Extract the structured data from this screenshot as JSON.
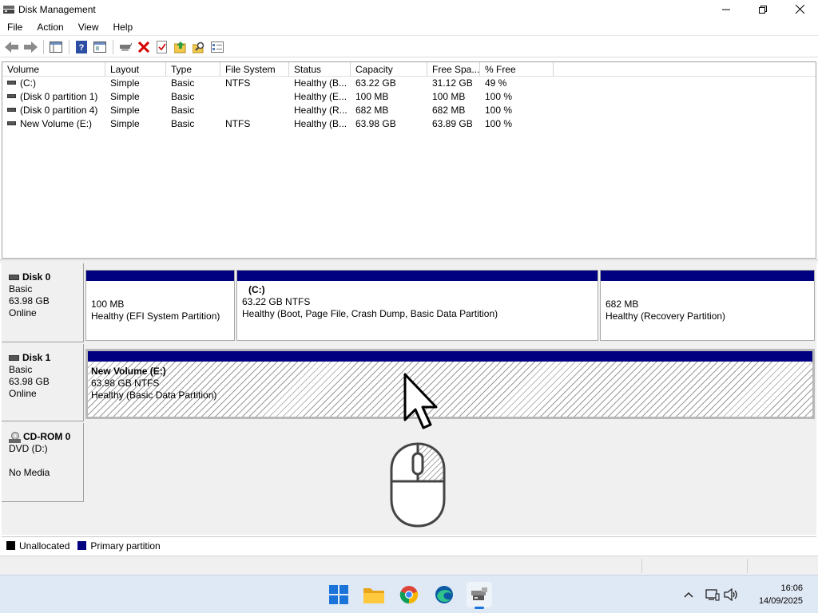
{
  "window": {
    "title": "Disk Management",
    "minimize": "─",
    "maximize": "❐",
    "close": "✕"
  },
  "menu": [
    "File",
    "Action",
    "View",
    "Help"
  ],
  "toolbar": {
    "buttons": [
      "back-icon",
      "forward-icon",
      "console-tree-icon",
      "help-icon",
      "properties-icon",
      "connect-icon",
      "delete-icon",
      "checklist-icon",
      "import-icon",
      "search-icon",
      "view-icon"
    ]
  },
  "volume_list": {
    "headers": [
      "Volume",
      "Layout",
      "Type",
      "File System",
      "Status",
      "Capacity",
      "Free Spa...",
      "% Free"
    ],
    "rows": [
      [
        "(C:)",
        "Simple",
        "Basic",
        "NTFS",
        "Healthy (B...",
        "63.22 GB",
        "31.12 GB",
        "49 %"
      ],
      [
        "(Disk 0 partition 1)",
        "Simple",
        "Basic",
        "",
        "Healthy (E...",
        "100 MB",
        "100 MB",
        "100 %"
      ],
      [
        "(Disk 0 partition 4)",
        "Simple",
        "Basic",
        "",
        "Healthy (R...",
        "682 MB",
        "682 MB",
        "100 %"
      ],
      [
        "New Volume (E:)",
        "Simple",
        "Basic",
        "NTFS",
        "Healthy (B...",
        "63.98 GB",
        "63.89 GB",
        "100 %"
      ]
    ]
  },
  "disks": [
    {
      "name": "Disk 0",
      "type": "Basic",
      "size": "63.98 GB",
      "state": "Online",
      "partitions": [
        {
          "name": "",
          "size": "100 MB",
          "status": "Healthy (EFI System Partition)"
        },
        {
          "name": "(C:)",
          "size": "63.22 GB NTFS",
          "status": "Healthy (Boot, Page File, Crash Dump, Basic Data Partition)"
        },
        {
          "name": "",
          "size": "682 MB",
          "status": "Healthy (Recovery Partition)"
        }
      ]
    },
    {
      "name": "Disk 1",
      "type": "Basic",
      "size": "63.98 GB",
      "state": "Online",
      "partitions": [
        {
          "name": "New Volume  (E:)",
          "size": "63.98 GB NTFS",
          "status": "Healthy (Basic Data Partition)"
        }
      ]
    },
    {
      "name": "CD-ROM 0",
      "type": "DVD (D:)",
      "state": "No Media"
    }
  ],
  "legend": [
    {
      "label": "Unallocated",
      "color": "#000000"
    },
    {
      "label": "Primary partition",
      "color": "#000080"
    }
  ],
  "taskbar": {
    "apps": [
      "windows-start-icon",
      "file-explorer-icon",
      "chrome-icon",
      "edge-icon",
      "disk-management-icon"
    ],
    "tray": [
      "chevron-up-icon",
      "network-icon",
      "volume-icon"
    ],
    "time": "16:06",
    "date": "14/09/2025"
  },
  "colors": {
    "primary_partition": "#000080",
    "taskbar": "#dfe8f5"
  }
}
